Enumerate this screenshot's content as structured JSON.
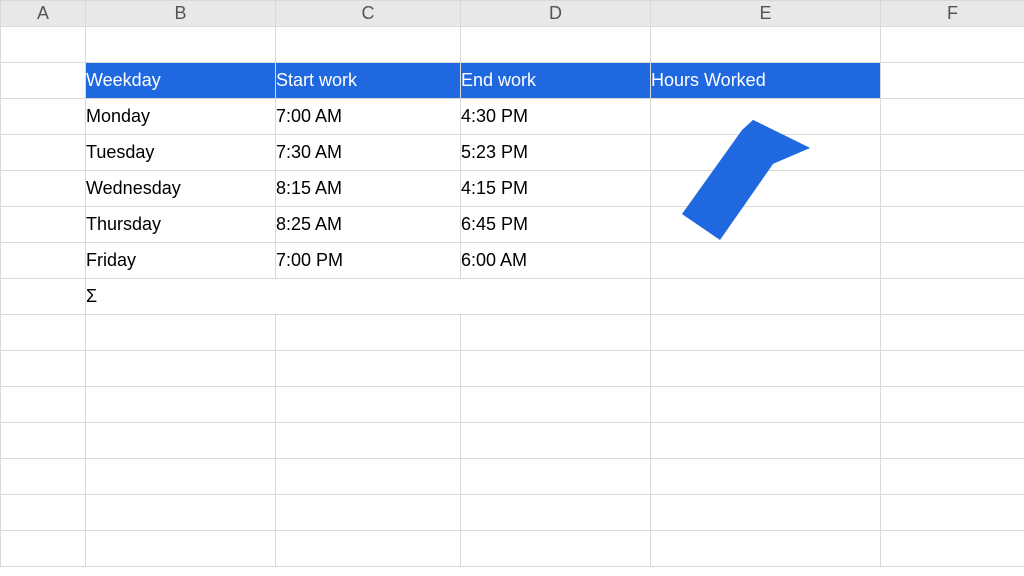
{
  "columns": [
    "A",
    "B",
    "C",
    "D",
    "E",
    "F"
  ],
  "header_row": {
    "weekday": "Weekday",
    "start": "Start work",
    "end": "End work",
    "hours": "Hours Worked"
  },
  "rows": [
    {
      "weekday": "Monday",
      "start": "7:00 AM",
      "end": "4:30 PM",
      "hours": ""
    },
    {
      "weekday": "Tuesday",
      "start": "7:30 AM",
      "end": "5:23 PM",
      "hours": ""
    },
    {
      "weekday": "Wednesday",
      "start": "8:15 AM",
      "end": "4:15 PM",
      "hours": ""
    },
    {
      "weekday": "Thursday",
      "start": "8:25 AM",
      "end": "6:45 PM",
      "hours": ""
    },
    {
      "weekday": "Friday",
      "start": "7:00 PM",
      "end": "6:00 AM",
      "hours": ""
    }
  ],
  "sum_symbol": "Σ",
  "arrow_color": "#1f68e0",
  "chart_data": {
    "type": "table",
    "title": "",
    "columns": [
      "Weekday",
      "Start work",
      "End work",
      "Hours Worked"
    ],
    "data": [
      [
        "Monday",
        "7:00 AM",
        "4:30 PM",
        ""
      ],
      [
        "Tuesday",
        "7:30 AM",
        "5:23 PM",
        ""
      ],
      [
        "Wednesday",
        "8:15 AM",
        "4:15 PM",
        ""
      ],
      [
        "Thursday",
        "8:25 AM",
        "6:45 PM",
        ""
      ],
      [
        "Friday",
        "7:00 PM",
        "6:00 AM",
        ""
      ],
      [
        "Σ",
        "",
        "",
        ""
      ]
    ]
  }
}
